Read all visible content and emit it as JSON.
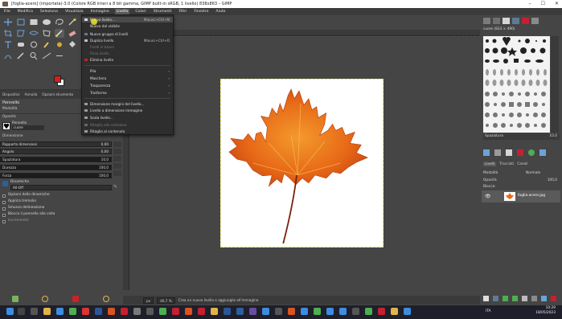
{
  "window": {
    "title": "[foglia-acero] (importata)-3.0 (Colore RGB interi a 8 bit gamma, GIMP built-in sRGB, 1 livello) 838x863 – GIMP"
  },
  "menubar": [
    "File",
    "Modifica",
    "Seleziona",
    "Visualizza",
    "Immagine",
    "Livello",
    "Colori",
    "Strumenti",
    "Filtri",
    "Finestre",
    "Aiuto"
  ],
  "layer_menu": {
    "items": [
      {
        "label": "Nuovo livello...",
        "shortcut": "Maiusc+Ctrl+N",
        "disabled": false,
        "submenu": false
      },
      {
        "label": "Nuovo dal visibile",
        "shortcut": "",
        "disabled": false,
        "submenu": false
      },
      {
        "label": "Nuovo gruppo di livelli",
        "shortcut": "",
        "disabled": false,
        "submenu": false
      },
      {
        "label": "Duplica livello",
        "shortcut": "Maiusc+Ctrl+D",
        "disabled": false,
        "submenu": false
      },
      {
        "label": "Fondi in basso",
        "shortcut": "",
        "disabled": true,
        "submenu": false
      },
      {
        "label": "Fissa livello",
        "shortcut": "",
        "disabled": true,
        "submenu": false
      },
      {
        "label": "Elimina livello",
        "shortcut": "",
        "disabled": false,
        "submenu": false
      },
      {
        "label": "Pila",
        "shortcut": "",
        "disabled": false,
        "submenu": true
      },
      {
        "label": "Maschera",
        "shortcut": "",
        "disabled": false,
        "submenu": true
      },
      {
        "label": "Trasparenza",
        "shortcut": "",
        "disabled": false,
        "submenu": true
      },
      {
        "label": "Trasforma",
        "shortcut": "",
        "disabled": false,
        "submenu": true
      },
      {
        "label": "Dimensione margini del livello...",
        "shortcut": "",
        "disabled": false,
        "submenu": false
      },
      {
        "label": "Livello a dimensione immagine",
        "shortcut": "",
        "disabled": false,
        "submenu": false
      },
      {
        "label": "Scala livello...",
        "shortcut": "",
        "disabled": false,
        "submenu": false
      },
      {
        "label": "Ritaglia alla selezione",
        "shortcut": "",
        "disabled": true,
        "submenu": false
      },
      {
        "label": "Ritaglia al contenuto",
        "shortcut": "",
        "disabled": false,
        "submenu": false
      }
    ]
  },
  "dock_tabs": [
    "Dispositivi",
    "Annulla",
    "Opzioni strumento"
  ],
  "tool_options": {
    "title": "Pennello",
    "mode_label": "Modalità",
    "opacity_label": "Opacità",
    "brush_label": "Pennello",
    "brush_name": "cuore",
    "dimension_label": "Dimensione",
    "sliders": [
      {
        "label": "Rapporto dimensioni",
        "value": "0,00"
      },
      {
        "label": "Angolo",
        "value": "0,00"
      },
      {
        "label": "Spaziatura",
        "value": "10,0"
      },
      {
        "label": "Durezza",
        "value": "100,0"
      },
      {
        "label": "Forza",
        "value": "100,0"
      }
    ],
    "dynamics_label": "Dinamiche",
    "dynamics_value": "All-Off",
    "options": [
      {
        "label": "Opzioni delle dinamiche",
        "checked": false
      },
      {
        "label": "Applica tremolio",
        "checked": false
      },
      {
        "label": "Smussa delineazione",
        "checked": false
      },
      {
        "label": "Blocca il pennello alla vista",
        "checked": false
      },
      {
        "label": "Incremental",
        "checked": false
      }
    ]
  },
  "status": {
    "unit": "px",
    "zoom": "46,7 %",
    "message": "Crea un nuovo livello e aggiungilo all'immagine"
  },
  "brushes": {
    "header": "cuore (833 × 490)"
  },
  "right_options": {
    "spacing_label": "Spaziatura",
    "spacing_value": "10,0"
  },
  "layers": {
    "tabs": [
      "Livelli",
      "Tracciati",
      "Canali"
    ],
    "mode_label": "Modalità",
    "mode_value": "Normale",
    "opacity_label": "Opacità",
    "opacity_value": "100,0",
    "lock_label": "Blocca:",
    "items": [
      {
        "name": "foglia-acero.jpg"
      }
    ]
  },
  "taskbar": {
    "time": "10:29",
    "date": "18/05/2023",
    "lang": "ITA"
  },
  "colors": {
    "fg": "#101010",
    "bg": "#ffffff",
    "accent_fg_swatch": "#d81b1b",
    "leaf": "#e8681a"
  }
}
